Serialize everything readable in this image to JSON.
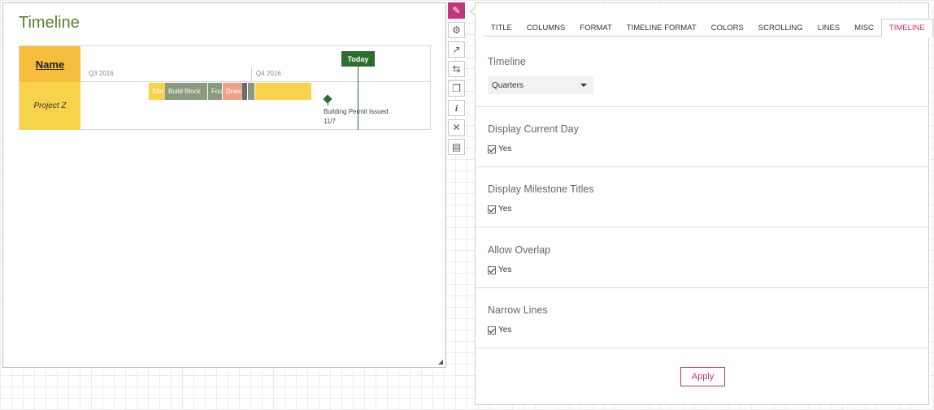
{
  "widget": {
    "title": "Timeline",
    "name_header": "Name",
    "quarters": [
      "Q3 2016",
      "Q4 2016"
    ],
    "rows": [
      {
        "label": "Project Z",
        "bars": [
          {
            "label": "Site",
            "color": "#f8d24a"
          },
          {
            "label": "Build Block",
            "color": "#8a9a7e"
          },
          {
            "label": "Fou",
            "color": "#8a9a7e"
          },
          {
            "label": "Draw",
            "color": "#f0a086"
          },
          {
            "label": "",
            "color": "#6b6b6b"
          },
          {
            "label": "",
            "color": "#8a9a7e"
          },
          {
            "label": "",
            "color": "#f8d24a"
          }
        ]
      }
    ],
    "today_label": "Today",
    "milestone": {
      "title": "Building Permit Issued",
      "date": "11/7",
      "color": "#2c6e2d"
    }
  },
  "toolbar": {
    "buttons": [
      {
        "name": "edit-pencil",
        "glyph": "✎",
        "active": true
      },
      {
        "name": "settings",
        "glyph": "⚙",
        "active": false
      },
      {
        "name": "open-external",
        "glyph": "↗",
        "active": false
      },
      {
        "name": "swap",
        "glyph": "⇆",
        "active": false
      },
      {
        "name": "duplicate",
        "glyph": "❐",
        "active": false
      },
      {
        "name": "info",
        "glyph": "i",
        "active": false
      },
      {
        "name": "close",
        "glyph": "✕",
        "active": false
      },
      {
        "name": "save",
        "glyph": "▤",
        "active": false
      }
    ]
  },
  "panel": {
    "tabs": [
      "TITLE",
      "COLUMNS",
      "FORMAT",
      "TIMELINE FORMAT",
      "COLORS",
      "SCROLLING",
      "LINES",
      "MISC",
      "TIMELINE"
    ],
    "active_tab": "TIMELINE",
    "timeline_label": "Timeline",
    "timeline_value": "Quarters",
    "display_current_day": {
      "label": "Display Current Day",
      "value": "Yes"
    },
    "display_milestone_titles": {
      "label": "Display Milestone Titles",
      "value": "Yes"
    },
    "allow_overlap": {
      "label": "Allow Overlap",
      "value": "Yes"
    },
    "narrow_lines": {
      "label": "Narrow Lines",
      "value": "Yes"
    },
    "apply_label": "Apply"
  },
  "colors": {
    "accent": "#c2357a",
    "title_green": "#5b7f2e",
    "today_green": "#2c6e2d"
  }
}
